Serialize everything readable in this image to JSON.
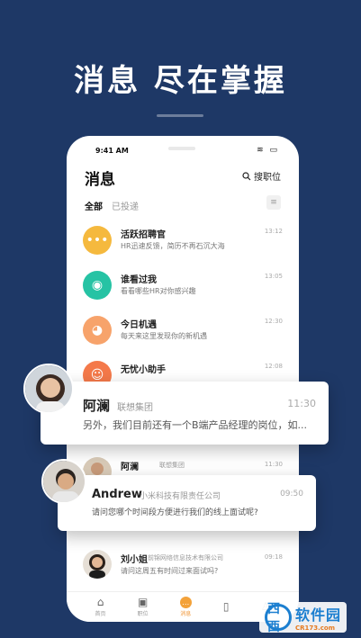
{
  "headline": "消息 尽在掌握",
  "status": {
    "time": "9:41 AM"
  },
  "page": {
    "title": "消息",
    "search_label": "搜职位"
  },
  "tabs": [
    {
      "label": "全部"
    },
    {
      "label": "已投递"
    }
  ],
  "messages": [
    {
      "name": "活跃招聘官",
      "text": "HR迅速反馈，简历不再石沉大海",
      "time": "13:12",
      "icon": "chat-bubble-icon",
      "color": "#f5b93e"
    },
    {
      "name": "谁看过我",
      "text": "看看哪些HR对你感兴趣",
      "time": "13:05",
      "icon": "eye-icon",
      "color": "#26c3a4"
    },
    {
      "name": "今日机遇",
      "text": "每天来这里发现你的新机遇",
      "time": "12:30",
      "icon": "pig-icon",
      "color": "#f7a36b"
    },
    {
      "name": "无忧小助手",
      "text": "",
      "time": "12:08",
      "icon": "assistant-icon",
      "color": "#f4794a"
    }
  ],
  "under_card_row": {
    "name": "阿澜",
    "company": "联想集团",
    "time": "11:30"
  },
  "last_row": {
    "name": "刘小姐",
    "company": "前锦网络信息技术有限公司",
    "text": "请问这周五有时间过来面试吗?",
    "time": "09:18"
  },
  "tabbar": [
    {
      "label": "首页",
      "icon": "home-icon"
    },
    {
      "label": "职位",
      "icon": "briefcase-icon"
    },
    {
      "label": "消息",
      "icon": "message-icon"
    },
    {
      "label": "",
      "icon": "book-icon"
    },
    {
      "label": "",
      "icon": "profile-icon"
    }
  ],
  "card1": {
    "name": "阿澜",
    "company": "联想集团",
    "time": "11:30",
    "text": "另外，我们目前还有一个B端产品经理的岗位，如..."
  },
  "card2": {
    "name": "Andrew",
    "company": "小米科技有限责任公司",
    "time": "09:50",
    "text": "请问您哪个时间段方便进行我们的线上面试呢?"
  },
  "watermark": {
    "main": "软件园",
    "sub": "CR173.com",
    "circle": "西西"
  }
}
